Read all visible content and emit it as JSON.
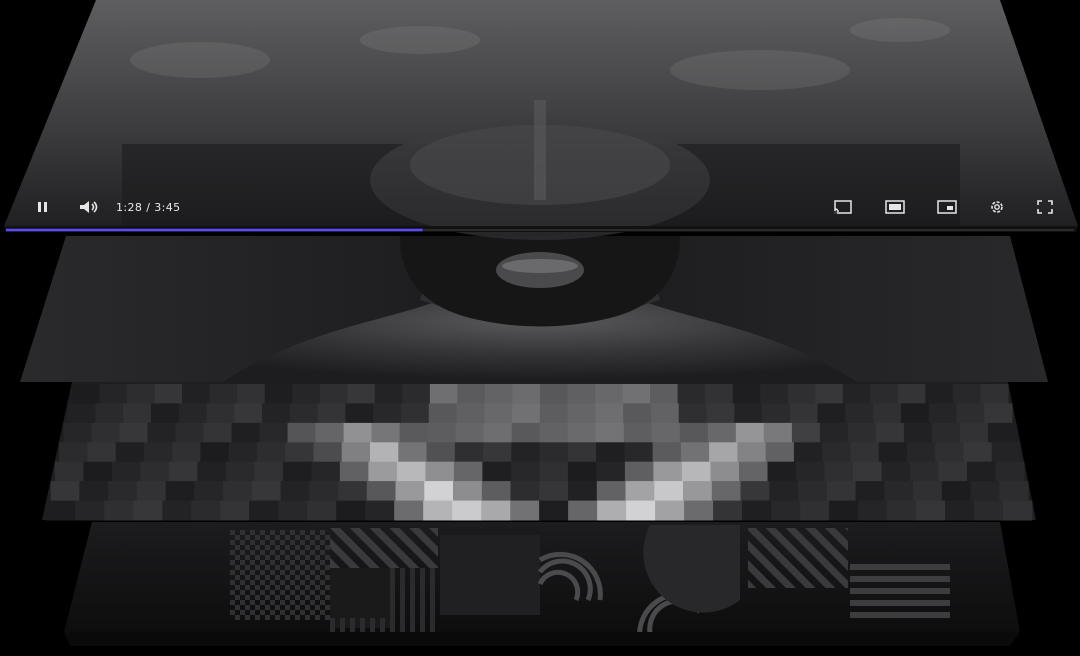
{
  "player": {
    "time": "1:28 / 3:45",
    "progress_fraction": 0.39
  },
  "icons": {
    "play_pause": "pause-icon",
    "volume": "volume-icon",
    "cast": "cast-icon",
    "theater": "theater-mode-icon",
    "miniplayer": "miniplayer-icon",
    "settings": "gear-icon",
    "fullscreen": "fullscreen-icon"
  },
  "colors": {
    "progress": "#5b49ff",
    "background": "#000000"
  }
}
